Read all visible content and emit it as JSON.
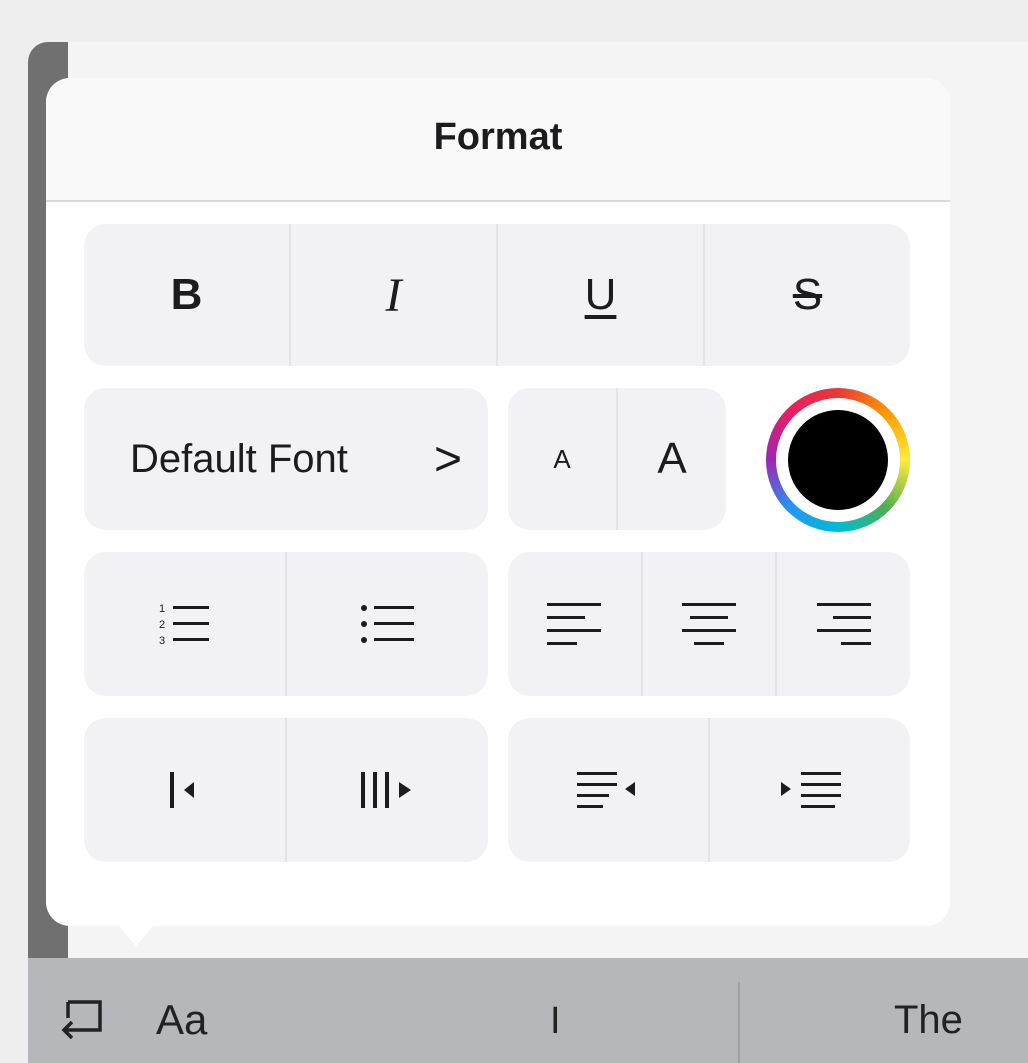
{
  "popover": {
    "title": "Format",
    "style_buttons": [
      {
        "label": "B",
        "icon": "bold-icon"
      },
      {
        "label": "I",
        "icon": "italic-icon"
      },
      {
        "label": "U",
        "icon": "underline-icon"
      },
      {
        "label": "S",
        "icon": "strikethrough-icon"
      }
    ],
    "font": {
      "label": "Default Font",
      "chevron": ">"
    },
    "size": {
      "smaller": "A",
      "larger": "A"
    },
    "color": {
      "current": "#000000",
      "icon": "color-wheel-icon"
    },
    "lists": [
      "numbered-list-icon",
      "bulleted-list-icon"
    ],
    "alignment": [
      "align-left-icon",
      "align-center-icon",
      "align-right-icon"
    ],
    "indent": [
      "decrease-indent-icon",
      "increase-indent-icon"
    ],
    "direction": [
      "rtl-paragraph-icon",
      "ltr-paragraph-icon"
    ]
  },
  "keyboard_toolbar": {
    "undo_icon": "undo-icon",
    "format_label": "Aa",
    "suggestion_1": "I",
    "suggestion_2": "The"
  }
}
